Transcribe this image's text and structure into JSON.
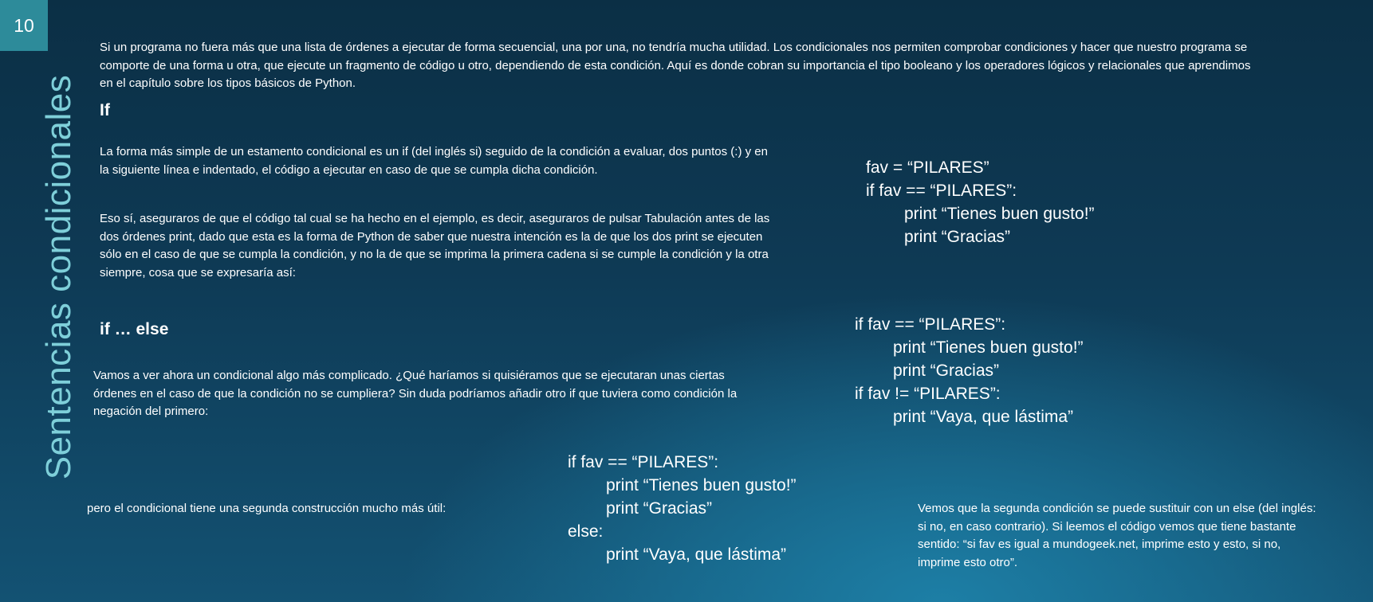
{
  "slide": {
    "number": "10",
    "title": "Sentencias condicionales"
  },
  "intro": "Si un programa no fuera más que una lista de órdenes a ejecutar de forma secuencial, una por una, no tendría mucha utilidad. Los condicionales nos permiten comprobar condiciones y hacer que nuestro programa se comporte de una forma u otra, que ejecute un fragmento de código u otro, dependiendo de esta condición. Aquí es donde cobran su importancia el tipo booleano y los operadores lógicos y relacionales que aprendimos en el capítulo sobre los tipos básicos de Python.",
  "if_section": {
    "heading": "If",
    "para1": "La forma más simple de un estamento condicional es un if (del inglés si) seguido de la condición a evaluar, dos puntos (:) y en la siguiente línea e indentado, el código a ejecutar en caso de que se cumpla dicha condición.",
    "para2": "Eso sí, aseguraros de que el código tal cual se ha hecho en el ejemplo, es decir, aseguraros de pulsar Tabulación antes de las dos órdenes print, dado que esta es la forma de Python de saber que nuestra intención es la de que los dos print se ejecuten sólo en el caso de que se cumpla la condición, y no la de que se imprima la primera cadena si se cumple la condición y la otra siempre, cosa que se expresaría así:"
  },
  "ifelse_section": {
    "heading": "if … else",
    "para1": "Vamos a ver ahora un condicional algo más complicado. ¿Qué haríamos si quisiéramos que se ejecutaran unas ciertas órdenes en el caso de que la condición no se cumpliera? Sin duda podríamos añadir otro if que tuviera como condición la negación del primero:",
    "para2": "pero el condicional tiene una segunda construcción mucho más útil:",
    "para3": "Vemos que la segunda condición se puede sustituir con un else (del inglés: si no, en caso contrario). Si leemos el código vemos que tiene bastante sentido: “si fav es igual a mundogeek.net, imprime esto y esto, si no, imprime esto otro”."
  },
  "code1": {
    "l1": "fav = “PILARES”",
    "l2": "if fav == “PILARES”:",
    "l3": "print “Tienes buen gusto!”",
    "l4": "print “Gracias”"
  },
  "code2": {
    "l1": "if fav == “PILARES”:",
    "l2": "print “Tienes buen gusto!”",
    "l3": "print “Gracias”",
    "l4": "if fav != “PILARES”:",
    "l5": "print “Vaya, que lástima”"
  },
  "code3": {
    "l1": "if fav == “PILARES”:",
    "l2": "print “Tienes buen gusto!”",
    "l3": "print “Gracias”",
    "l4": "else:",
    "l5": "print “Vaya, que lástima”"
  }
}
